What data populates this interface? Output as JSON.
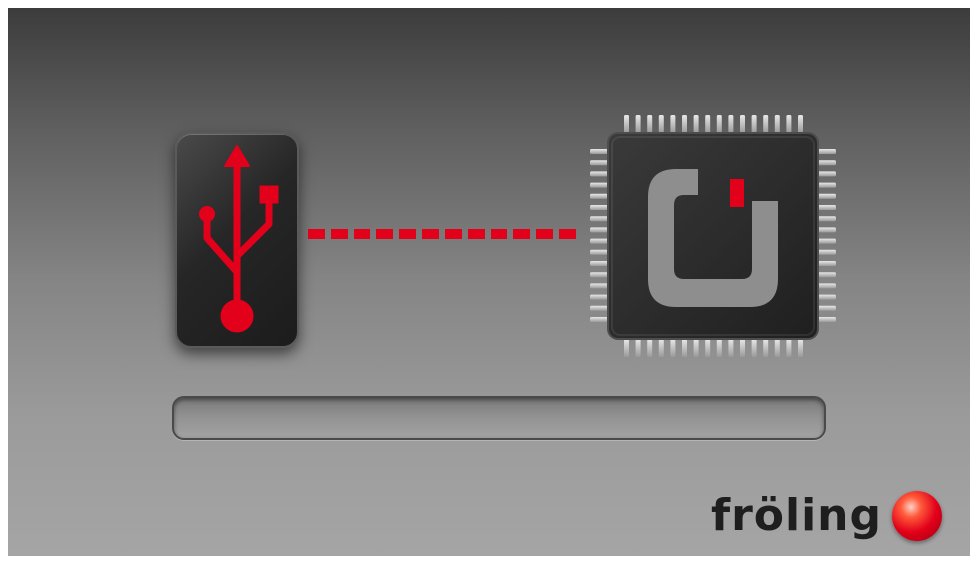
{
  "app": {
    "screen": "usb-firmware-update"
  },
  "icons": {
    "source": "usb-icon",
    "target": "microcontroller-chip-icon",
    "link": "dashed-transfer-line"
  },
  "progress": {
    "value_percent": 0
  },
  "brand": {
    "wordmark": "fröling",
    "logo": "red-sphere-logo"
  },
  "colors": {
    "accent": "#e2001a",
    "chip_body": "#2b2b2b",
    "chip_logo": "#8e8e8e",
    "background_top": "#3c3c3c",
    "background_bottom": "#a5a5a5"
  }
}
